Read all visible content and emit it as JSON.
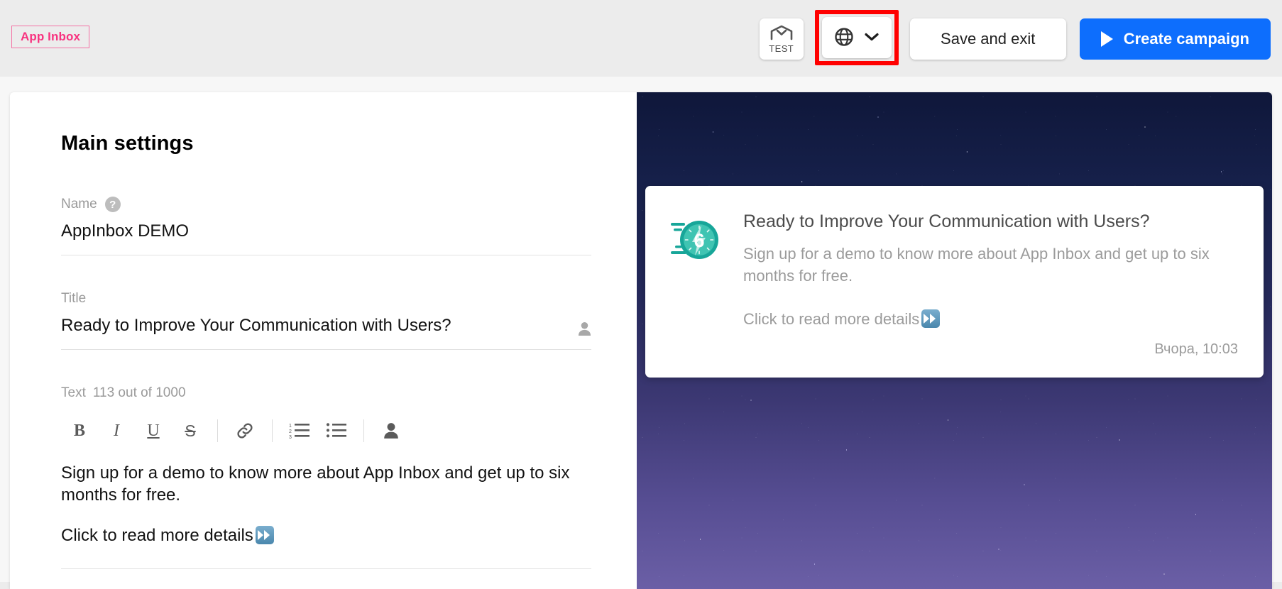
{
  "topbar": {
    "chip_label": "App Inbox",
    "test_button_label": "TEST",
    "save_label": "Save and exit",
    "create_label": "Create campaign",
    "highlight_color": "#ff0000",
    "accent_blue": "#0d6efd",
    "chip_pink": "#f8327f"
  },
  "form": {
    "heading": "Main settings",
    "name": {
      "label": "Name",
      "help_glyph": "?",
      "value": "AppInbox DEMO"
    },
    "title": {
      "label": "Title",
      "value": "Ready to Improve Your Communication with Users?"
    },
    "text": {
      "label": "Text",
      "counter": "113 out of 1000",
      "toolbar": [
        {
          "name": "bold",
          "glyph": "B"
        },
        {
          "name": "italic",
          "glyph": "I"
        },
        {
          "name": "underline",
          "glyph": "U"
        },
        {
          "name": "strikethrough",
          "glyph": "S"
        }
      ],
      "paragraph_1": "Sign up for a demo to know more about App Inbox and get up to six months for free.",
      "paragraph_2": "Click to read more details"
    }
  },
  "preview": {
    "card": {
      "title": "Ready to Improve Your Communication with Users?",
      "description": "Sign up for a demo to know more about App Inbox and get up to six months for free.",
      "cta": "Click to read more details",
      "timestamp": "Вчора, 10:03",
      "icon_number": "6",
      "icon_color": "#17a699"
    },
    "background": {
      "top_color": "#0f173a",
      "bottom_color": "#6b5fa6"
    }
  }
}
